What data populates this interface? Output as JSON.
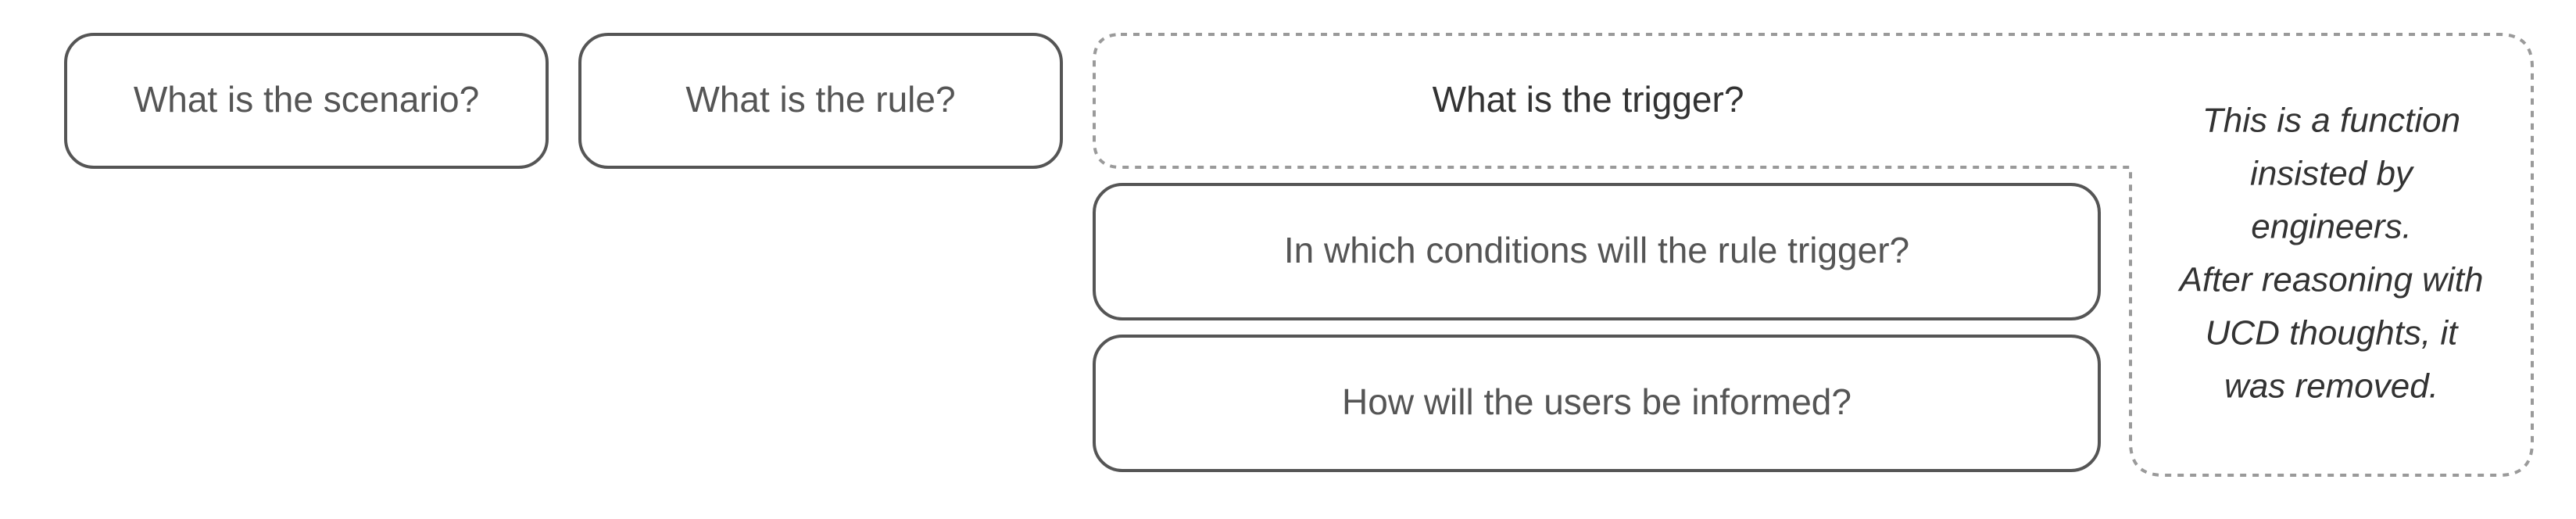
{
  "boxes": {
    "scenario": "What is the scenario?",
    "rule": "What is the rule?",
    "trigger": "What is the trigger?",
    "conditions": "In which conditions will the rule trigger?",
    "inform": "How will the users be informed?"
  },
  "note": {
    "lines": [
      "This is a function",
      "insisted by",
      "engineers.",
      "After reasoning with",
      "UCD thoughts, it",
      "was removed."
    ]
  }
}
